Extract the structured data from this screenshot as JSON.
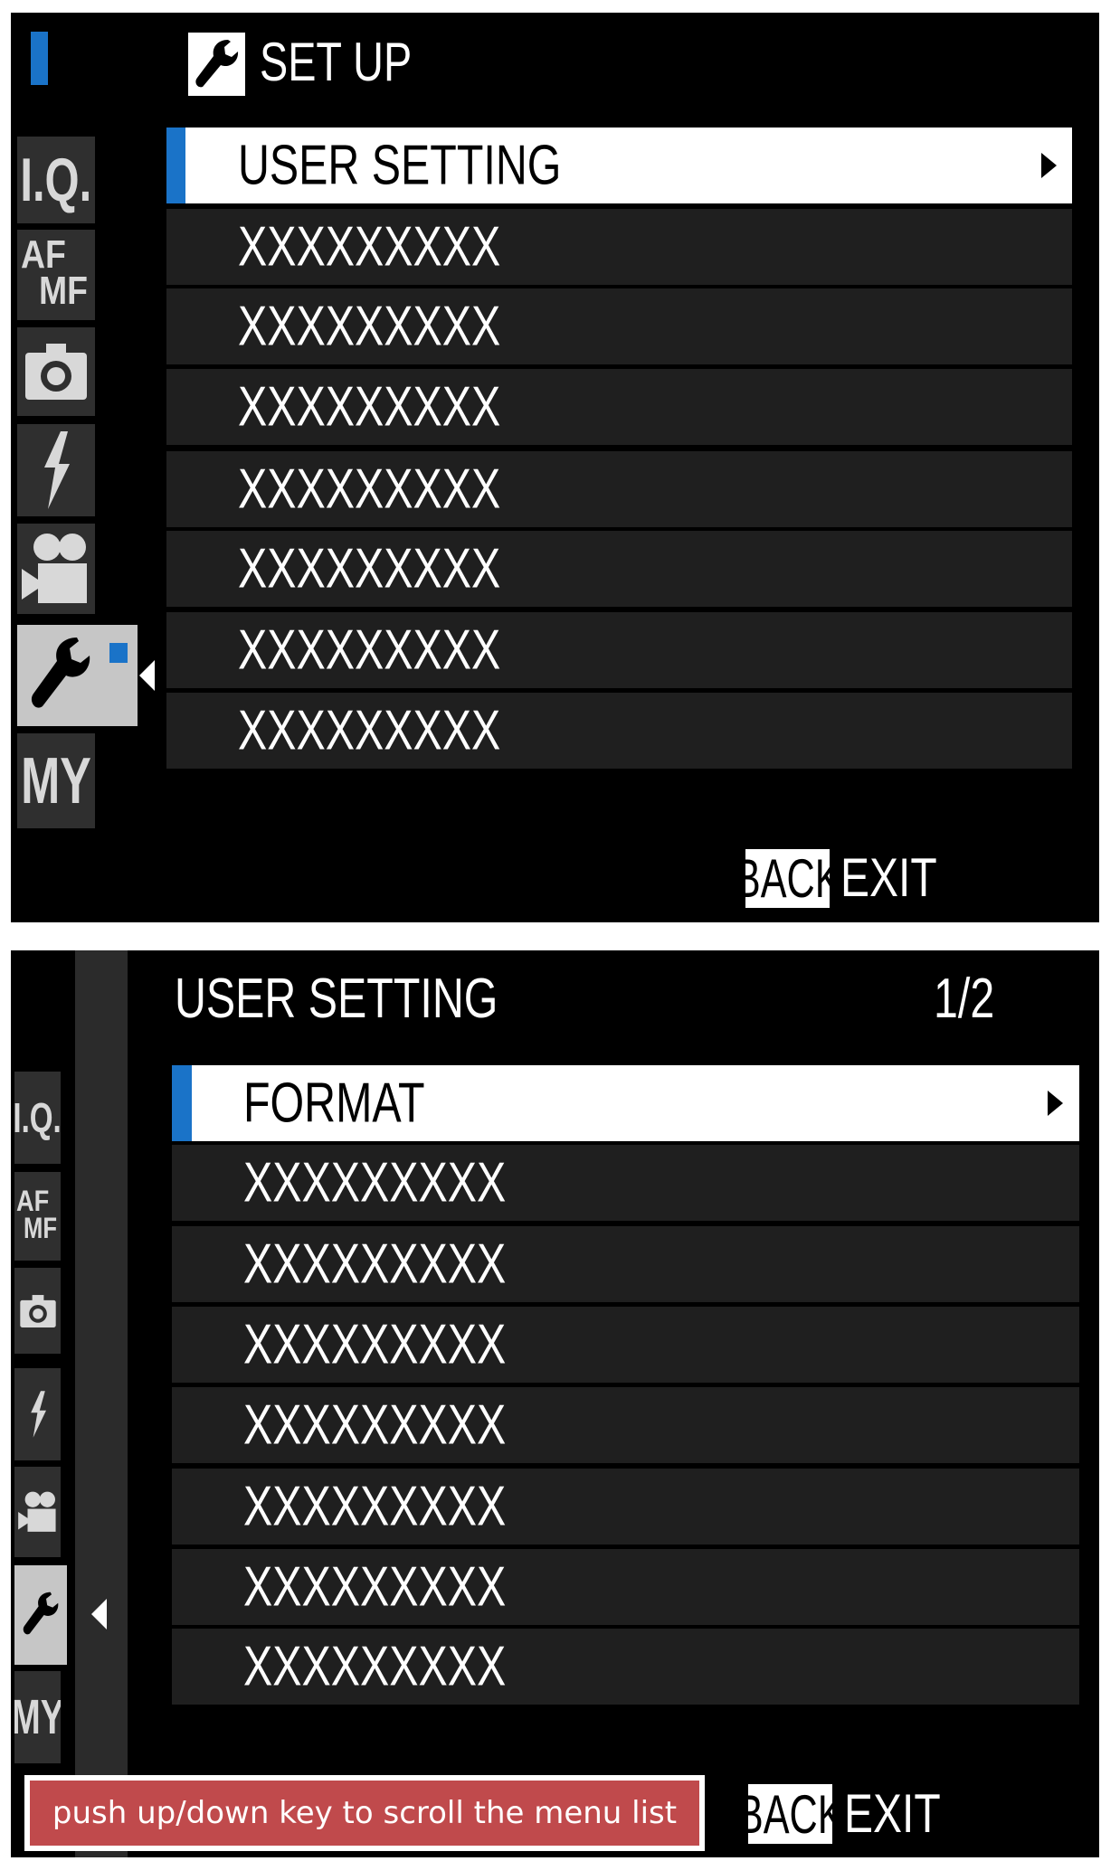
{
  "screen1": {
    "title": "SET UP",
    "title_icon": "wrench-icon",
    "accent_color": "#1a73c8",
    "tabs": [
      {
        "label": "I.Q.",
        "icon": "image-quality-icon"
      },
      {
        "label": "AF MF",
        "icon": "af-mf-icon"
      },
      {
        "label": "",
        "icon": "camera-icon"
      },
      {
        "label": "",
        "icon": "flash-icon"
      },
      {
        "label": "",
        "icon": "movie-camera-icon"
      },
      {
        "label": "",
        "icon": "wrench-icon",
        "active": true
      },
      {
        "label": "MY",
        "icon": "my-menu-icon"
      }
    ],
    "items": [
      {
        "label": "USER SETTING",
        "selected": true
      },
      {
        "label": "XXXXXXXXX"
      },
      {
        "label": "XXXXXXXXX"
      },
      {
        "label": "XXXXXXXXX"
      },
      {
        "label": "XXXXXXXXX"
      },
      {
        "label": "XXXXXXXXX"
      },
      {
        "label": "XXXXXXXXX"
      },
      {
        "label": "XXXXXXXXX"
      }
    ],
    "footer": {
      "back_label": "BACK",
      "exit_label": "EXIT"
    }
  },
  "screen2": {
    "title": "USER SETTING",
    "page_indicator": "1/2",
    "tabs": [
      {
        "label": "I.Q.",
        "icon": "image-quality-icon"
      },
      {
        "label": "AF MF",
        "icon": "af-mf-icon"
      },
      {
        "label": "",
        "icon": "camera-icon"
      },
      {
        "label": "",
        "icon": "flash-icon"
      },
      {
        "label": "",
        "icon": "movie-camera-icon"
      },
      {
        "label": "",
        "icon": "wrench-icon",
        "active": true
      },
      {
        "label": "MY",
        "icon": "my-menu-icon"
      }
    ],
    "items": [
      {
        "label": "FORMAT",
        "selected": true
      },
      {
        "label": "XXXXXXXXX"
      },
      {
        "label": "XXXXXXXXX"
      },
      {
        "label": "XXXXXXXXX"
      },
      {
        "label": "XXXXXXXXX"
      },
      {
        "label": "XXXXXXXXX"
      },
      {
        "label": "XXXXXXXXX"
      },
      {
        "label": "XXXXXXXXX"
      }
    ],
    "footer": {
      "back_label": "BACK",
      "exit_label": "EXIT"
    }
  },
  "hint": {
    "text": "push up/down key to scroll the menu list",
    "color": "#c04a4c"
  }
}
